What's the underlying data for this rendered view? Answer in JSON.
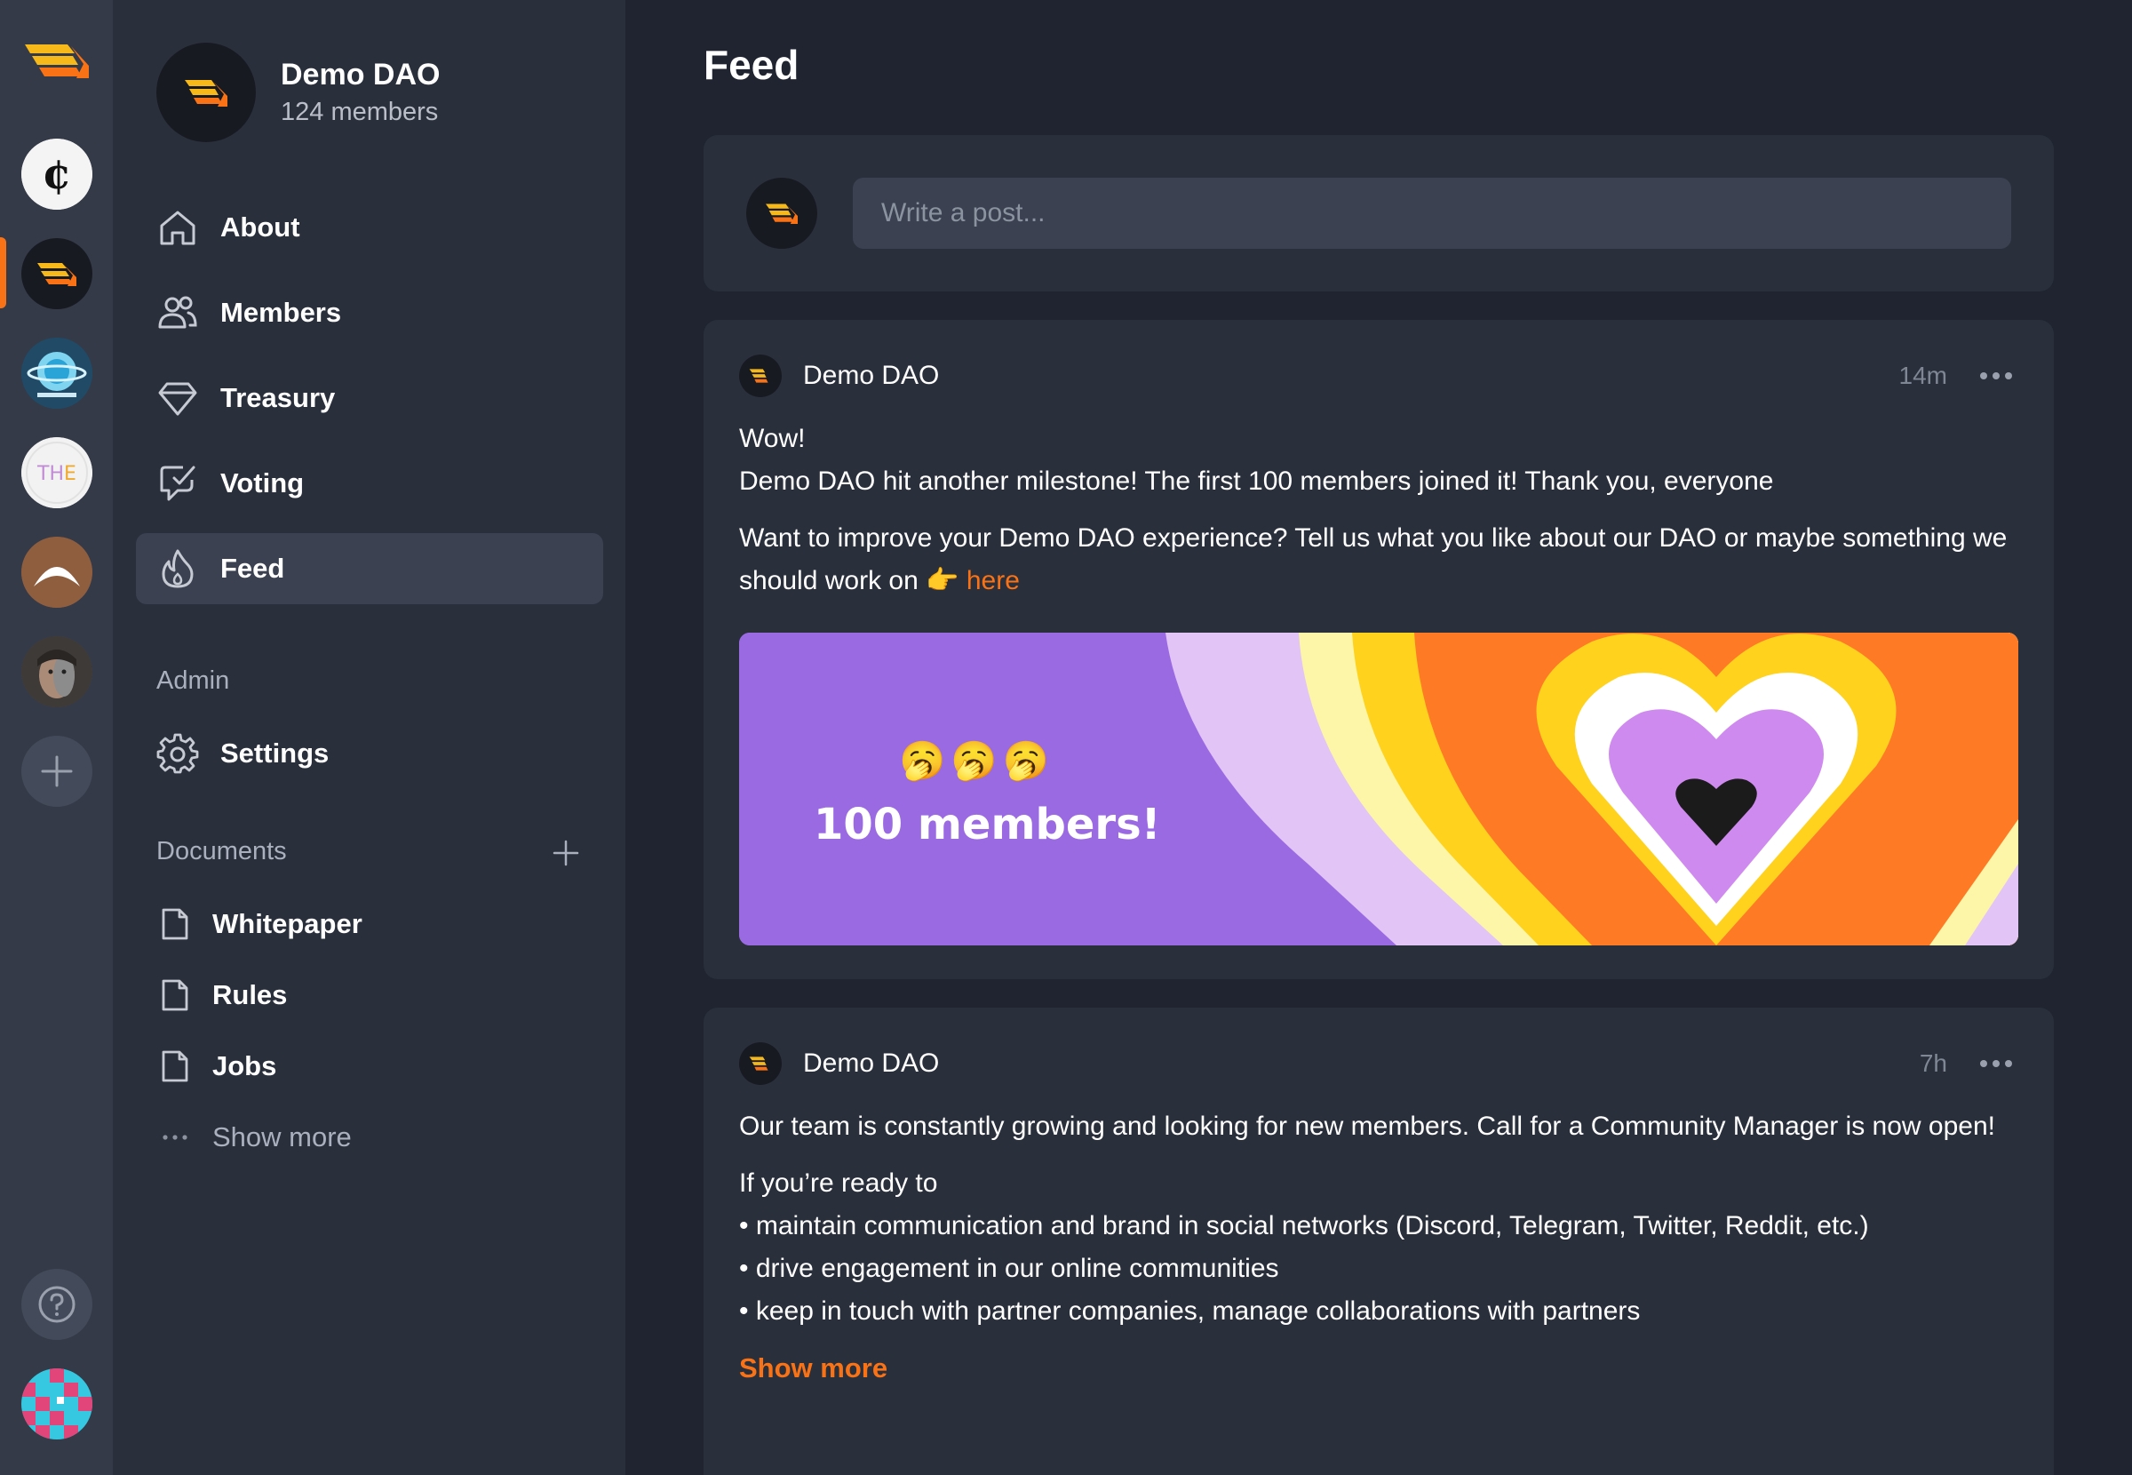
{
  "dao": {
    "name": "Demo DAO",
    "members": "124 members"
  },
  "nav": {
    "items": [
      {
        "label": "About",
        "icon": "home-icon"
      },
      {
        "label": "Members",
        "icon": "users-icon"
      },
      {
        "label": "Treasury",
        "icon": "diamond-icon"
      },
      {
        "label": "Voting",
        "icon": "vote-check-icon"
      },
      {
        "label": "Feed",
        "icon": "flame-icon",
        "active": true
      }
    ],
    "admin_label": "Admin",
    "settings_label": "Settings",
    "documents_label": "Documents",
    "documents": [
      "Whitepaper",
      "Rules",
      "Jobs"
    ],
    "show_more": "Show more"
  },
  "rail": {
    "items": [
      "chain-c-icon",
      "demo-dao-icon",
      "planet-icon",
      "the-icon",
      "arrow-a-icon",
      "face-icon"
    ],
    "active_index": 1,
    "accent": "#f97316"
  },
  "feed": {
    "title": "Feed",
    "composer_placeholder": "Write a post...",
    "posts": [
      {
        "author": "Demo DAO",
        "time": "14m",
        "line1": "Wow!",
        "line2": "Demo DAO hit another milestone! The first 100 members joined it! Thank you, everyone",
        "line3": "Want to improve your Demo DAO experience? Tell us what you like about our DAO or maybe something we should work on 👉",
        "link": "here",
        "banner_emoji": "🥱🥱🥱",
        "banner_text": "100 members!"
      },
      {
        "author": "Demo DAO",
        "time": "7h",
        "para1": "Our team is constantly growing and looking for new members. Call for a Community Manager is now open!",
        "intro": "If you’re ready to",
        "bullets": [
          "• maintain communication and brand in social networks (Discord, Telegram, Twitter, Reddit, etc.)",
          "• drive engagement in our online communities",
          "• keep in touch with partner companies, manage collaborations with partners"
        ],
        "show_more": "Show more"
      }
    ]
  }
}
